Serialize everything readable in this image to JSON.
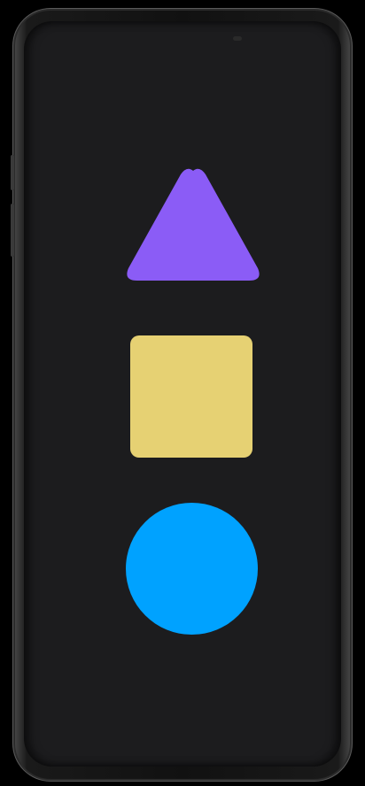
{
  "device": {
    "frame_color": "#1a1a1a",
    "screen_color": "#1c1c1e"
  },
  "shapes": [
    {
      "name": "triangle",
      "color": "#8b5cf6"
    },
    {
      "name": "square",
      "color": "#e6d173"
    },
    {
      "name": "circle",
      "color": "#00a2ff"
    }
  ]
}
